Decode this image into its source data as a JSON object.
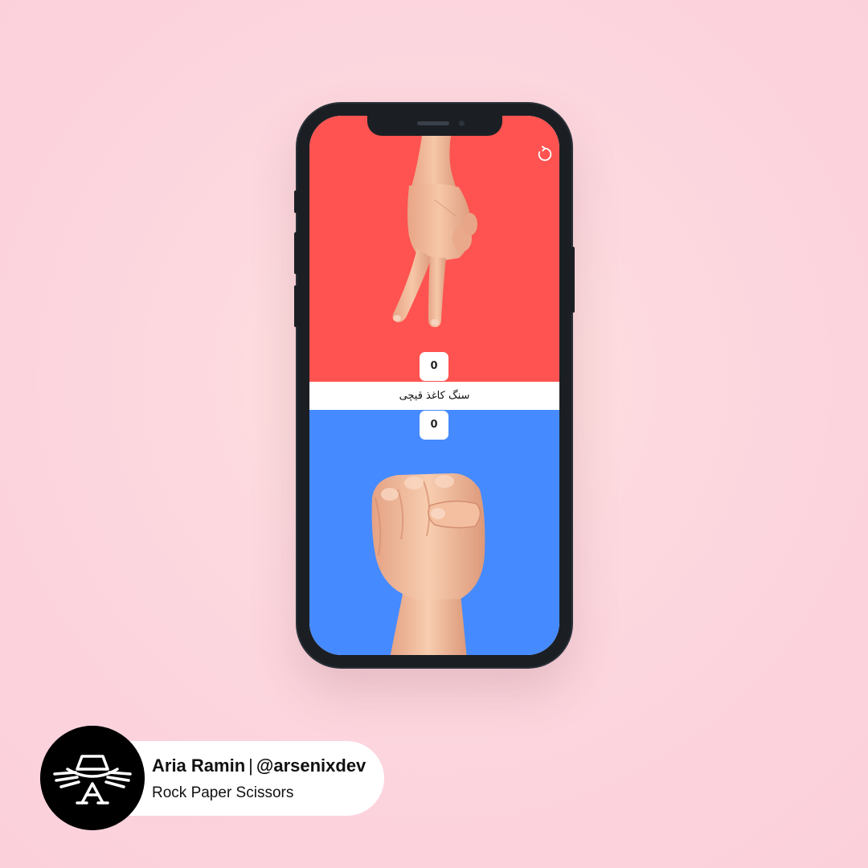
{
  "app": {
    "title": "سنگ کاغذ قیچی",
    "colors": {
      "opponent_side": "#fe5350",
      "player_side": "#458aff",
      "middle_bar": "#ffffff"
    }
  },
  "scores": {
    "opponent": "0",
    "player": "0"
  },
  "hands": {
    "opponent_choice": "scissors",
    "player_choice": "rock"
  },
  "icons": {
    "reset": "reset-icon"
  },
  "author": {
    "name": "Aria Ramin",
    "separator": "|",
    "handle": "@arsenixdev",
    "project": "Rock Paper Scissors"
  }
}
